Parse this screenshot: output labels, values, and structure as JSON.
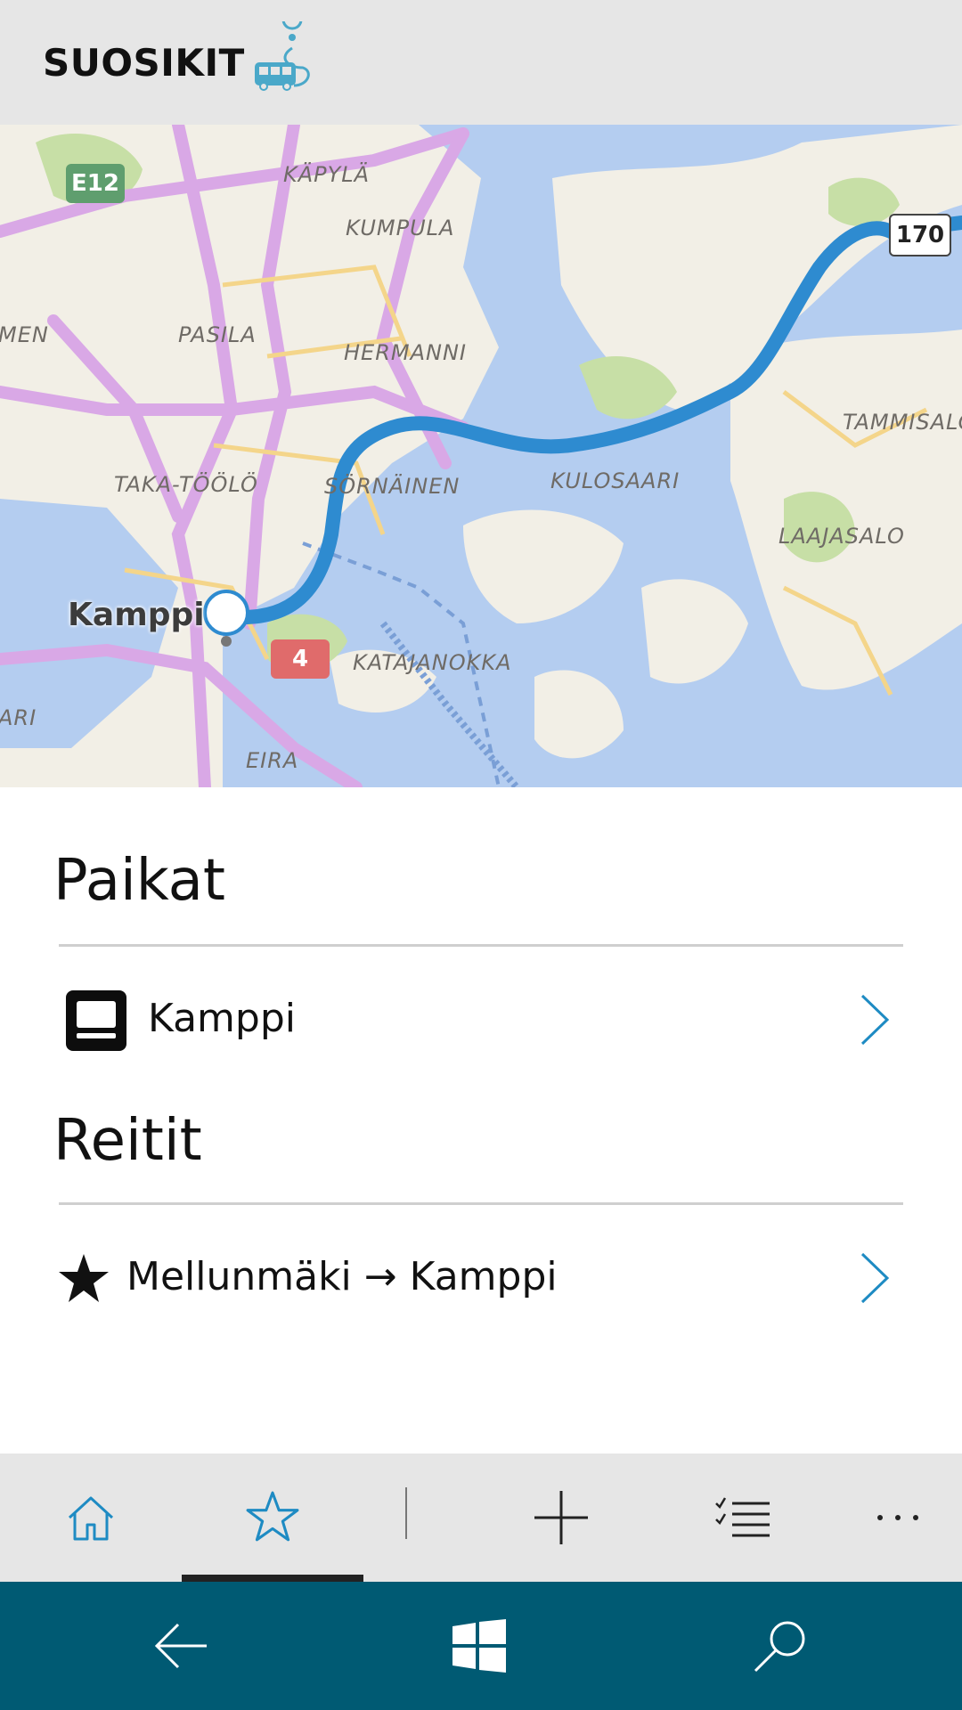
{
  "header": {
    "title": "SUOSIKIT",
    "logo_icon": "bus-route-icon"
  },
  "map": {
    "places": [
      "KÄPYLÄ",
      "KUMPULA",
      "PASILA",
      "HERMANNI",
      "TAMMISALO",
      "TAKA-TÖÖLÖ",
      "SÖRNÄINEN",
      "KULOSAARI",
      "LAAJASALO",
      "KATAJANOKKA",
      "EIRA",
      "MEN",
      "ARI"
    ],
    "highlighted_place": "Kamppi",
    "route_shields": [
      "E12",
      "170",
      "4"
    ],
    "route_color": "#2e8bd0"
  },
  "sections": {
    "places_title": "Paikat",
    "routes_title": "Reitit"
  },
  "places": [
    {
      "label": "Kamppi",
      "icon": "metro-icon"
    }
  ],
  "routes": [
    {
      "label": "Mellunmäki → Kamppi",
      "icon": "star-icon"
    }
  ],
  "appbar": {
    "buttons": [
      "home-icon",
      "star-icon",
      "add-icon",
      "checklist-icon",
      "more-icon"
    ],
    "active": "star-icon",
    "accent": "#1e8bc3"
  },
  "navbar": {
    "buttons": [
      "back-arrow-icon",
      "windows-icon",
      "search-icon"
    ],
    "color": "#005a73"
  }
}
